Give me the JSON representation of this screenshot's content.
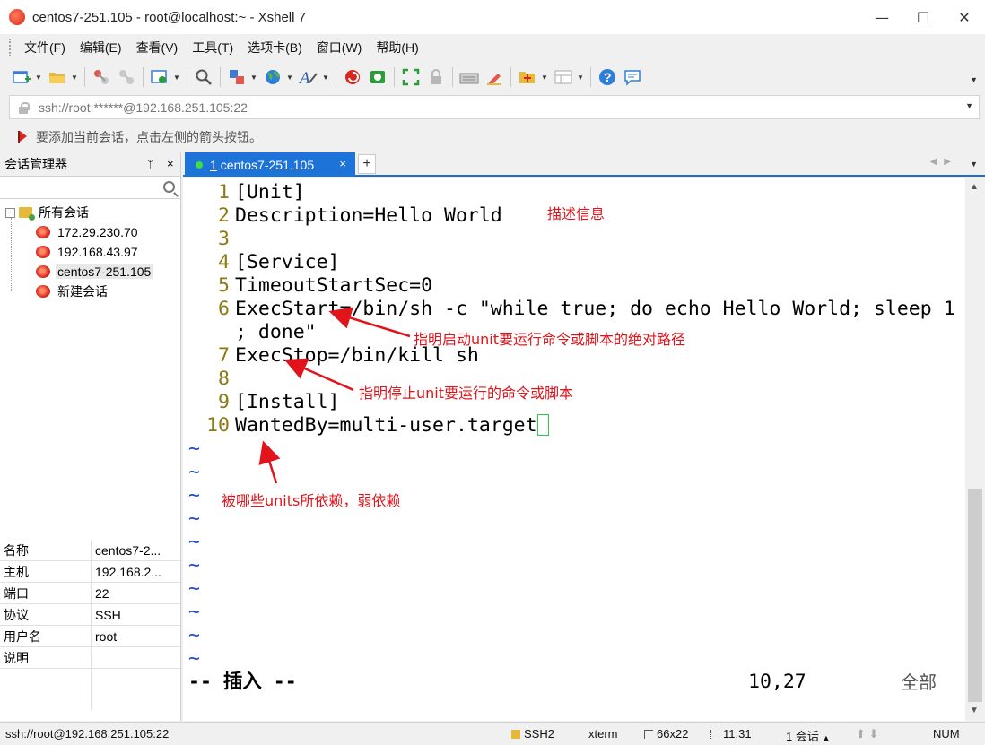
{
  "window": {
    "title": "centos7-251.105 - root@localhost:~ - Xshell 7",
    "controls": [
      "—",
      "☐",
      "✕"
    ]
  },
  "menu": [
    "文件(F)",
    "编辑(E)",
    "查看(V)",
    "工具(T)",
    "选项卡(B)",
    "窗口(W)",
    "帮助(H)"
  ],
  "address": {
    "value": "ssh://root:******@192.168.251.105:22"
  },
  "hint": {
    "text": "要添加当前会话，点击左侧的箭头按钮。"
  },
  "session_manager": {
    "title": "会话管理器",
    "pin": "ᛘ",
    "close": "×",
    "root_label": "所有会话",
    "sessions": [
      "172.29.230.70",
      "192.168.43.97",
      "centos7-251.105",
      "新建会话"
    ],
    "selected": "centos7-251.105",
    "properties": [
      {
        "key": "名称",
        "value": "centos7-2..."
      },
      {
        "key": "主机",
        "value": "192.168.2..."
      },
      {
        "key": "端口",
        "value": "22"
      },
      {
        "key": "协议",
        "value": "SSH"
      },
      {
        "key": "用户名",
        "value": "root"
      },
      {
        "key": "说明",
        "value": ""
      }
    ]
  },
  "tab": {
    "number": "1",
    "label": "centos7-251.105",
    "close": "×",
    "add": "+"
  },
  "terminal": {
    "lines": [
      {
        "num": "1",
        "text": "[Unit]"
      },
      {
        "num": "2",
        "text": "Description=Hello World"
      },
      {
        "num": "3",
        "text": ""
      },
      {
        "num": "4",
        "text": "[Service]"
      },
      {
        "num": "5",
        "text": "TimeoutStartSec=0"
      },
      {
        "num": "6",
        "text": "ExecStart=/bin/sh -c \"while true; do echo Hello World; sleep 1"
      },
      {
        "num": "",
        "text": "; done\""
      },
      {
        "num": "7",
        "text": "ExecStop=/bin/kill sh"
      },
      {
        "num": "8",
        "text": ""
      },
      {
        "num": "9",
        "text": "[Install]"
      },
      {
        "num": "10",
        "text": "WantedBy=multi-user.target"
      }
    ],
    "tilde": "~",
    "mode": "-- 插入 --",
    "position": "10,27",
    "scope": "全部"
  },
  "annotations": {
    "description": "描述信息",
    "execstart": "指明启动unit要运行命令或脚本的绝对路径",
    "execstop": "指明停止unit要运行的命令或脚本",
    "wantedby": "被哪些units所依赖，弱依赖",
    "color": "#e0141a"
  },
  "status": {
    "connection": "ssh://root@192.168.251.105:22",
    "protocol": "SSH2",
    "terminal_type": "xterm",
    "size": "66x22",
    "cursor": "11,31",
    "sessions": "1 会话",
    "numlock": "NUM"
  },
  "colors": {
    "tab_active": "#1e73d8",
    "line_number": "#8c7a12",
    "tilde": "#1f46d6",
    "cursor": "#2fc94a"
  }
}
